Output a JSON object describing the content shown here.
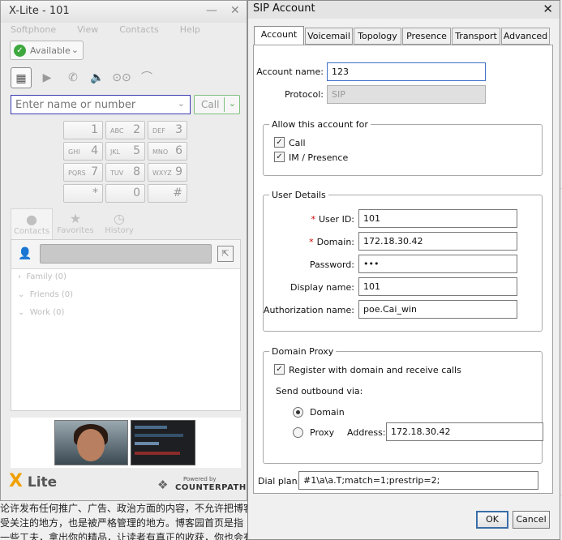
{
  "background": {
    "lines": [
      "论许发布任何推广、广告、政治方面的内容，不允许把博客当",
      "受关注的地方，也是被严格管理的地方。博客园首页是指",
      "一些工夫，拿出你的精品，让读者有真正的收获，你也会有很多收获"
    ]
  },
  "xlite": {
    "title": "X-Lite - 101",
    "menu": [
      "Softphone",
      "View",
      "Contacts",
      "Help"
    ],
    "presence": "Available",
    "dial_placeholder": "Enter name or number",
    "call_label": "Call",
    "keypad": [
      {
        "num": "1",
        "sub": ""
      },
      {
        "num": "2",
        "sub": "ABC"
      },
      {
        "num": "3",
        "sub": "DEF"
      },
      {
        "num": "4",
        "sub": "GHI"
      },
      {
        "num": "5",
        "sub": "JKL"
      },
      {
        "num": "6",
        "sub": "MNO"
      },
      {
        "num": "7",
        "sub": "PQRS"
      },
      {
        "num": "8",
        "sub": "TUV"
      },
      {
        "num": "9",
        "sub": "WXYZ"
      },
      {
        "num": "*",
        "sub": ""
      },
      {
        "num": "0",
        "sub": ""
      },
      {
        "num": "#",
        "sub": ""
      }
    ],
    "tabs": [
      "Contacts",
      "Favorites",
      "History"
    ],
    "groups": [
      "Family (0)",
      "Friends (0)",
      "Work (0)"
    ],
    "logo_text": "Lite",
    "logo_mark": "X",
    "powered_by": "Powered by",
    "brand": "COUNTERPATH"
  },
  "dialog": {
    "title": "SIP Account",
    "tabs": [
      "Account",
      "Voicemail",
      "Topology",
      "Presence",
      "Transport",
      "Advanced"
    ],
    "account_name_label": "Account name:",
    "account_name": "123",
    "protocol_label": "Protocol:",
    "protocol": "SIP",
    "allow_group": "Allow this account for",
    "allow_call": "Call",
    "allow_im": "IM / Presence",
    "user_group": "User Details",
    "user_id_label": "User ID:",
    "user_id": "101",
    "domain_label": "Domain:",
    "domain": "172.18.30.42",
    "password_label": "Password:",
    "password_mask": "•••",
    "display_name_label": "Display name:",
    "display_name": "101",
    "auth_name_label": "Authorization name:",
    "auth_name": "poe.Cai_win",
    "proxy_group": "Domain Proxy",
    "register_label": "Register with domain and receive calls",
    "send_outbound": "Send outbound via:",
    "opt_domain": "Domain",
    "opt_proxy": "Proxy",
    "address_label": "Address:",
    "address": "172.18.30.42",
    "dial_plan_label": "Dial plan:",
    "dial_plan": "#1\\a\\a.T;match=1;prestrip=2;",
    "ok": "OK",
    "cancel": "Cancel",
    "required_mark": "*"
  }
}
